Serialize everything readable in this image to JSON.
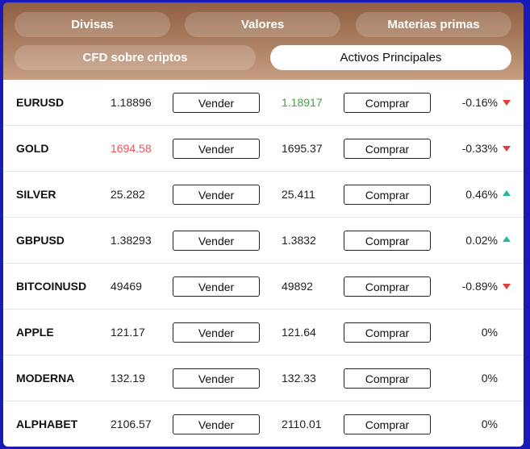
{
  "tabs": [
    {
      "label": "Divisas",
      "active": false
    },
    {
      "label": "Valores",
      "active": false
    },
    {
      "label": "Materias primas",
      "active": false
    },
    {
      "label": "CFD sobre criptos",
      "active": false
    },
    {
      "label": "Activos Principales",
      "active": true
    }
  ],
  "buttons": {
    "sell_label": "Vender",
    "buy_label": "Comprar"
  },
  "colors": {
    "price_up": "#4a9c4a",
    "price_down": "#f05454",
    "arrow_down": "#e63b3b",
    "arrow_up": "#26b79a"
  },
  "rows": [
    {
      "symbol": "EURUSD",
      "sell": "1.18896",
      "sell_color": "",
      "buy": "1.18917",
      "buy_color": "green",
      "change": "-0.16%",
      "trend": "down"
    },
    {
      "symbol": "GOLD",
      "sell": "1694.58",
      "sell_color": "red",
      "buy": "1695.37",
      "buy_color": "",
      "change": "-0.33%",
      "trend": "down"
    },
    {
      "symbol": "SILVER",
      "sell": "25.282",
      "sell_color": "",
      "buy": "25.411",
      "buy_color": "",
      "change": "0.46%",
      "trend": "up"
    },
    {
      "symbol": "GBPUSD",
      "sell": "1.38293",
      "sell_color": "",
      "buy": "1.3832",
      "buy_color": "",
      "change": "0.02%",
      "trend": "up"
    },
    {
      "symbol": "BITCOINUSD",
      "sell": "49469",
      "sell_color": "",
      "buy": "49892",
      "buy_color": "",
      "change": "-0.89%",
      "trend": "down"
    },
    {
      "symbol": "APPLE",
      "sell": "121.17",
      "sell_color": "",
      "buy": "121.64",
      "buy_color": "",
      "change": "0%",
      "trend": "none"
    },
    {
      "symbol": "MODERNA",
      "sell": "132.19",
      "sell_color": "",
      "buy": "132.33",
      "buy_color": "",
      "change": "0%",
      "trend": "none"
    },
    {
      "symbol": "ALPHABET",
      "sell": "2106.57",
      "sell_color": "",
      "buy": "2110.01",
      "buy_color": "",
      "change": "0%",
      "trend": "none"
    }
  ]
}
